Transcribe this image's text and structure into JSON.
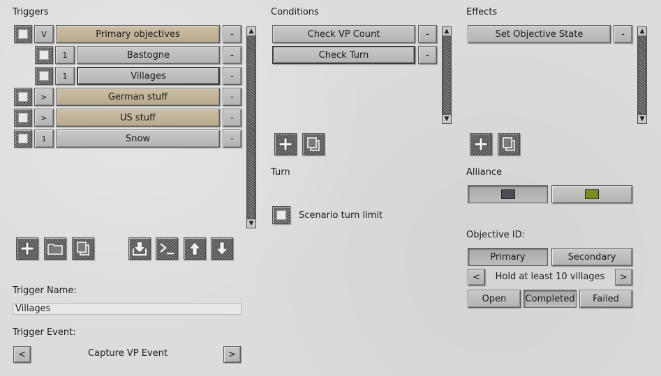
{
  "triggers": {
    "title": "Triggers",
    "items": [
      {
        "tag": "V",
        "label": "Primary objectives"
      },
      {
        "tag": "1",
        "label": "Bastogne"
      },
      {
        "tag": "1",
        "label": "Villages"
      },
      {
        "tag": ">",
        "label": "German stuff"
      },
      {
        "tag": ">",
        "label": "US stuff"
      },
      {
        "tag": "1",
        "label": "Snow"
      }
    ],
    "remove_label": "-"
  },
  "trigger_name": {
    "label": "Trigger Name:",
    "value": "Villages"
  },
  "trigger_event": {
    "label": "Trigger Event:",
    "value": "Capture VP Event",
    "prev": "<",
    "next": ">"
  },
  "conditions": {
    "title": "Conditions",
    "items": [
      {
        "label": "Check VP Count"
      },
      {
        "label": "Check Turn"
      }
    ],
    "remove_label": "-"
  },
  "turn": {
    "title": "Turn",
    "checkbox_label": "Scenario turn limit"
  },
  "effects": {
    "title": "Effects",
    "items": [
      {
        "label": "Set Objective State"
      }
    ],
    "remove_label": "-"
  },
  "alliance": {
    "title": "Alliance",
    "colors": [
      "#4a4d55",
      "#7d8a1e"
    ]
  },
  "objective": {
    "title": "Objective ID:",
    "types": [
      "Primary",
      "Secondary"
    ],
    "selected_type": "Primary",
    "name": "Hold at least 10 villages",
    "prev": "<",
    "next": ">",
    "states": [
      "Open",
      "Completed",
      "Failed"
    ],
    "selected_state": "Completed"
  },
  "icons": {
    "add": "plus-icon",
    "copy": "copy-icon",
    "folder": "folder-icon",
    "import": "download-icon",
    "console": "console-icon",
    "up": "arrow-up-icon",
    "down": "arrow-down-icon"
  }
}
